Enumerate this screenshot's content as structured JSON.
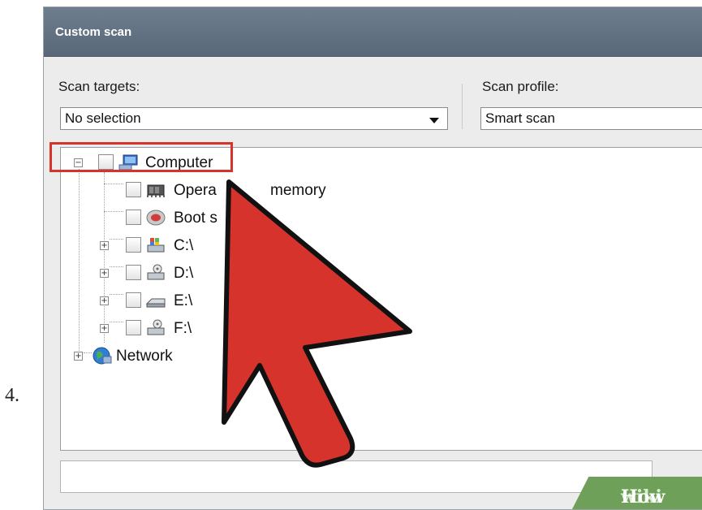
{
  "step": {
    "number": "4."
  },
  "window": {
    "title": "Custom scan"
  },
  "scan_targets": {
    "label": "Scan targets:",
    "value": "No selection"
  },
  "scan_profile": {
    "label": "Scan profile:",
    "value": "Smart scan"
  },
  "tree": {
    "computer": {
      "label": "Computer",
      "expanded": true,
      "icon": "computer-icon"
    },
    "children": [
      {
        "label": "Operating memory",
        "visible_label": "Opera",
        "visible_label_tail": "memory",
        "icon": "memory-chip-icon"
      },
      {
        "label": "Boot s",
        "icon": "boot-disk-icon"
      },
      {
        "label": "C:\\",
        "icon": "system-drive-icon"
      },
      {
        "label": "D:\\",
        "icon": "drive-icon"
      },
      {
        "label": "E:\\",
        "icon": "removable-drive-icon"
      },
      {
        "label": "F:\\",
        "icon": "drive-icon"
      }
    ],
    "network": {
      "label": "Network",
      "icon": "network-globe-icon"
    }
  },
  "overlay": {
    "cursor_color": "#d7332d",
    "highlight_color": "#d7332d"
  },
  "watermark": {
    "wiki": "wiki",
    "how": "How"
  }
}
